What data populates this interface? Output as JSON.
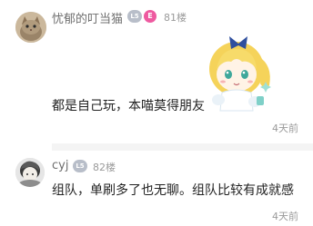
{
  "comments": [
    {
      "username": "忧郁的叮当猫",
      "level_badge": "L5",
      "special_badge": "E",
      "floor": "81楼",
      "content": "都是自己玩，本喵莫得朋友",
      "time": "4天前",
      "sticker": "anime-girl-sticker"
    },
    {
      "username": "cyj",
      "level_badge": "L5",
      "floor": "82楼",
      "content": "组队，单刷多了也无聊。组队比较有成就感",
      "time": "4天前"
    }
  ],
  "colors": {
    "username": "#6f6f6f",
    "content": "#222222",
    "meta": "#9a9a9a",
    "level_badge": "#b8bec9",
    "special_badge": "#ee5aa0"
  }
}
